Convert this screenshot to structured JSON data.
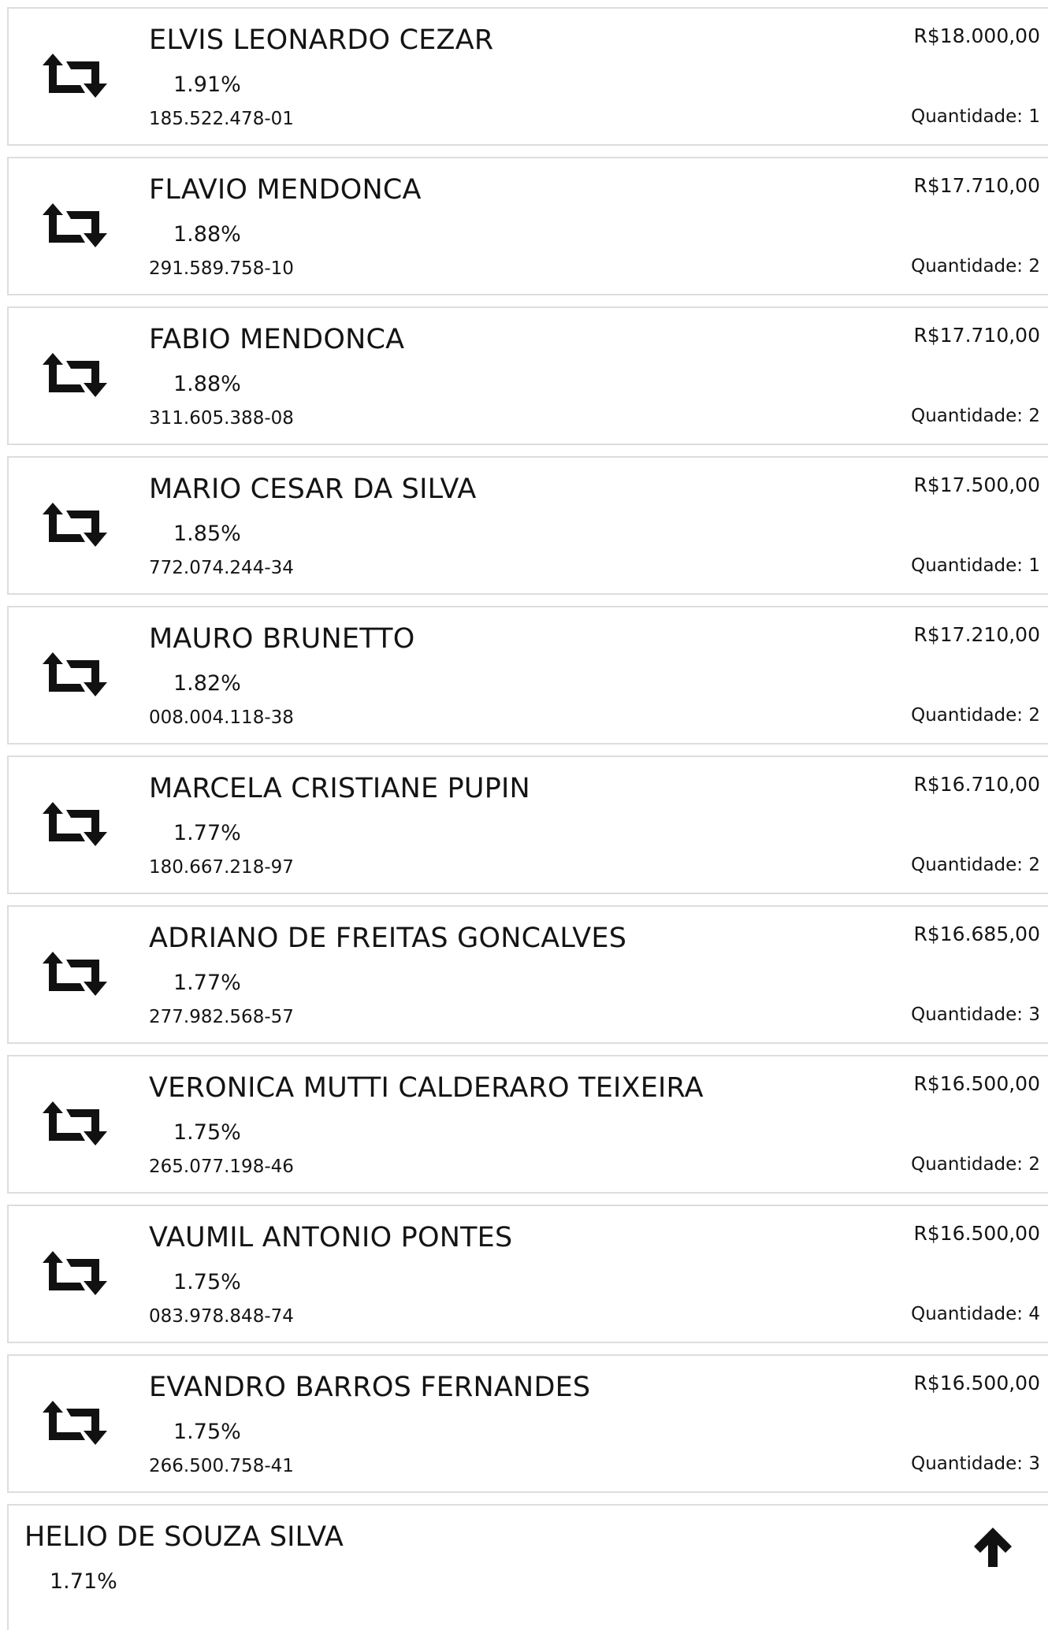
{
  "list": {
    "items": [
      {
        "icon": "transfer-icon",
        "name": "ELVIS LEONARDO CEZAR",
        "percent": "1.91%",
        "document": "185.522.478-01",
        "amount": "R$18.000,00",
        "quantity_label": "Quantidade:",
        "quantity": "1"
      },
      {
        "icon": "transfer-icon",
        "name": "FLAVIO MENDONCA",
        "percent": "1.88%",
        "document": "291.589.758-10",
        "amount": "R$17.710,00",
        "quantity_label": "Quantidade:",
        "quantity": "2"
      },
      {
        "icon": "transfer-icon",
        "name": "FABIO MENDONCA",
        "percent": "1.88%",
        "document": "311.605.388-08",
        "amount": "R$17.710,00",
        "quantity_label": "Quantidade:",
        "quantity": "2"
      },
      {
        "icon": "transfer-icon",
        "name": "MARIO CESAR DA SILVA",
        "percent": "1.85%",
        "document": "772.074.244-34",
        "amount": "R$17.500,00",
        "quantity_label": "Quantidade:",
        "quantity": "1"
      },
      {
        "icon": "transfer-icon",
        "name": "MAURO BRUNETTO",
        "percent": "1.82%",
        "document": "008.004.118-38",
        "amount": "R$17.210,00",
        "quantity_label": "Quantidade:",
        "quantity": "2"
      },
      {
        "icon": "transfer-icon",
        "name": "MARCELA CRISTIANE PUPIN",
        "percent": "1.77%",
        "document": "180.667.218-97",
        "amount": "R$16.710,00",
        "quantity_label": "Quantidade:",
        "quantity": "2"
      },
      {
        "icon": "transfer-icon",
        "name": "ADRIANO DE FREITAS GONCALVES",
        "percent": "1.77%",
        "document": "277.982.568-57",
        "amount": "R$16.685,00",
        "quantity_label": "Quantidade:",
        "quantity": "3"
      },
      {
        "icon": "transfer-icon",
        "name": "VERONICA MUTTI CALDERARO TEIXEIRA",
        "percent": "1.75%",
        "document": "265.077.198-46",
        "amount": "R$16.500,00",
        "quantity_label": "Quantidade:",
        "quantity": "2"
      },
      {
        "icon": "transfer-icon",
        "name": "VAUMIL ANTONIO PONTES",
        "percent": "1.75%",
        "document": "083.978.848-74",
        "amount": "R$16.500,00",
        "quantity_label": "Quantidade:",
        "quantity": "4"
      },
      {
        "icon": "transfer-icon",
        "name": "EVANDRO BARROS FERNANDES",
        "percent": "1.75%",
        "document": "266.500.758-41",
        "amount": "R$16.500,00",
        "quantity_label": "Quantidade:",
        "quantity": "3"
      }
    ],
    "partial_item": {
      "name": "HELIO DE SOUZA SILVA",
      "percent": "1.71%"
    }
  },
  "scroll_top": {
    "icon": "arrow-up-icon"
  },
  "colors": {
    "border": "#dddddd",
    "text": "#141414",
    "background": "#ffffff"
  }
}
